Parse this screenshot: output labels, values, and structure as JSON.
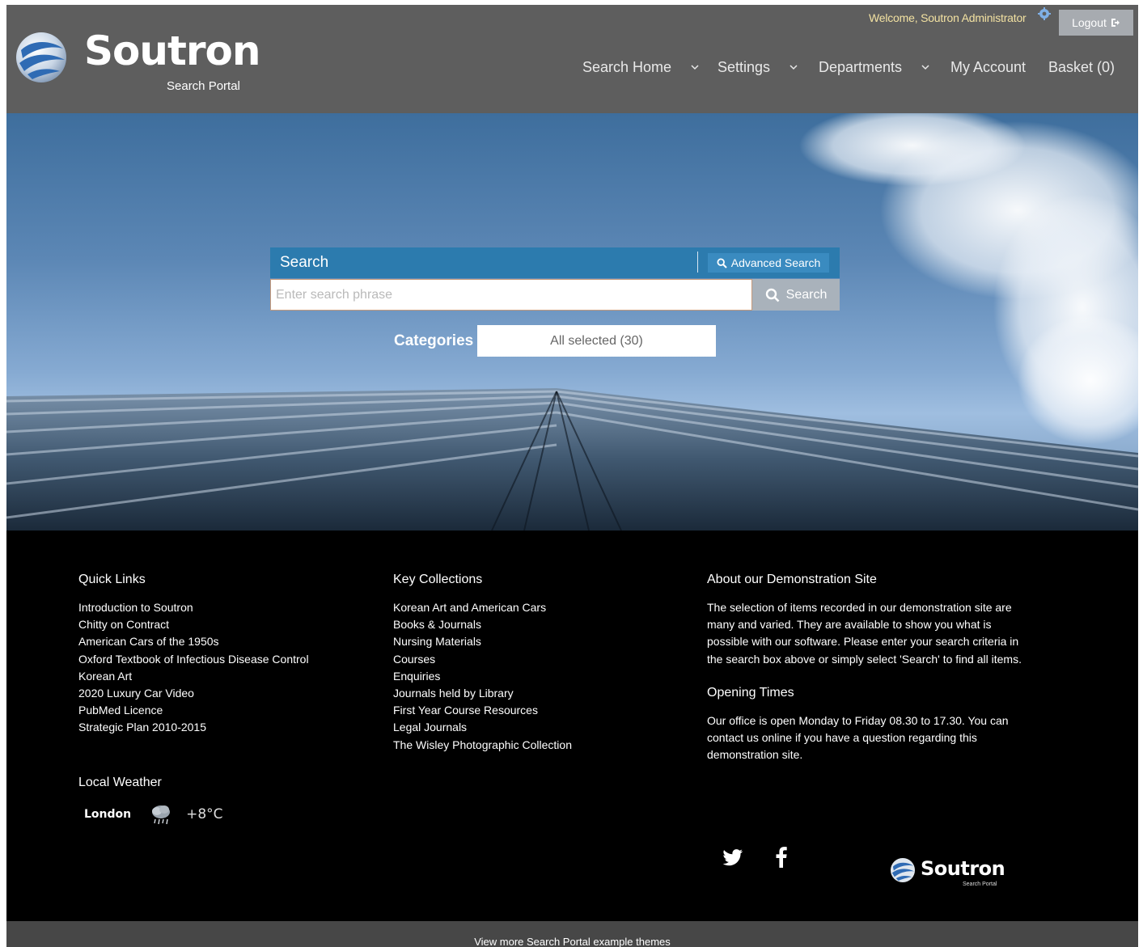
{
  "brand": {
    "name": "Soutron",
    "subtitle": "Search Portal"
  },
  "header": {
    "welcome": "Welcome, Soutron Administrator",
    "logout_label": "Logout",
    "nav": [
      {
        "label": "Search Home",
        "has_dropdown": true
      },
      {
        "label": "Settings",
        "has_dropdown": true
      },
      {
        "label": "Departments",
        "has_dropdown": true
      },
      {
        "label": "My Account",
        "has_dropdown": false
      },
      {
        "label": "Basket (0)",
        "has_dropdown": false
      }
    ]
  },
  "search": {
    "title": "Search",
    "advanced_label": "Advanced Search",
    "placeholder": "Enter search phrase",
    "value": "",
    "button_label": "Search",
    "categories_label": "Categories",
    "categories_value": "All selected (30)"
  },
  "footer": {
    "quick_links": {
      "title": "Quick Links",
      "items": [
        "Introduction to Soutron",
        "Chitty on Contract",
        "American Cars of the 1950s",
        "Oxford Textbook of Infectious Disease Control",
        "Korean Art",
        "2020 Luxury Car Video",
        "PubMed Licence",
        "Strategic Plan 2010-2015"
      ]
    },
    "key_collections": {
      "title": "Key Collections",
      "items": [
        "Korean Art and American Cars",
        "Books & Journals",
        "Nursing Materials",
        "Courses",
        "Enquiries",
        "Journals held by Library",
        "First Year Course Resources",
        "Legal Journals",
        "The Wisley Photographic Collection"
      ]
    },
    "about": {
      "title": "About our Demonstration Site",
      "text": "The selection of items recorded in our demonstration site are many and varied. They are available to show you what is possible with our software. Please enter your search criteria in the search box above or simply select 'Search' to find all items."
    },
    "opening": {
      "title": "Opening Times",
      "text": "Our office is open Monday to Friday 08.30 to 17.30. You can contact us online if you have a question regarding this demonstration site."
    },
    "weather": {
      "title": "Local Weather",
      "city": "London",
      "temp": "+8°C",
      "icon": "cloudy-rain-icon"
    },
    "social": [
      "twitter-icon",
      "facebook-icon"
    ],
    "bottom_link": "View more Search Portal example themes"
  },
  "colors": {
    "header_bg": "#5e5e5e",
    "search_head": "#2c7bae",
    "footer_bg": "#000000",
    "welcome_text": "#f3e2a2"
  }
}
